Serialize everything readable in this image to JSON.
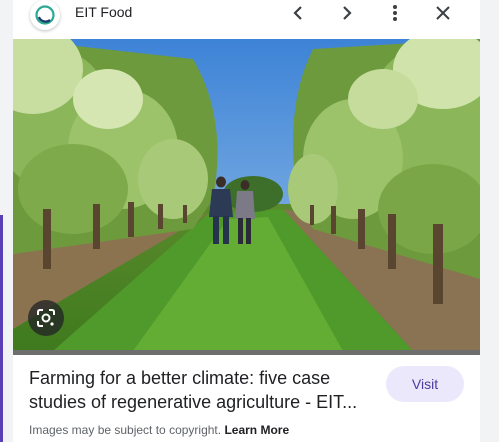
{
  "header": {
    "source_name": "EIT Food",
    "icons": [
      "eit-food-logo-icon",
      "chevron-left-icon",
      "chevron-right-icon",
      "more-vert-icon",
      "close-icon"
    ]
  },
  "image": {
    "alt": "Two people walking between rows of trees in an orchard"
  },
  "result": {
    "title_line1": "Farming for a better climate: five case",
    "title_line2": "studies of regenerative agriculture - EIT...",
    "visit_label": "Visit"
  },
  "footer": {
    "copyright_text": "Images may be subject to copyright.",
    "learn_more": "Learn More"
  },
  "colors": {
    "accent_purple": "#5b3fb6",
    "visit_bg": "#ece8fb",
    "visit_text": "#4b3aa0"
  }
}
